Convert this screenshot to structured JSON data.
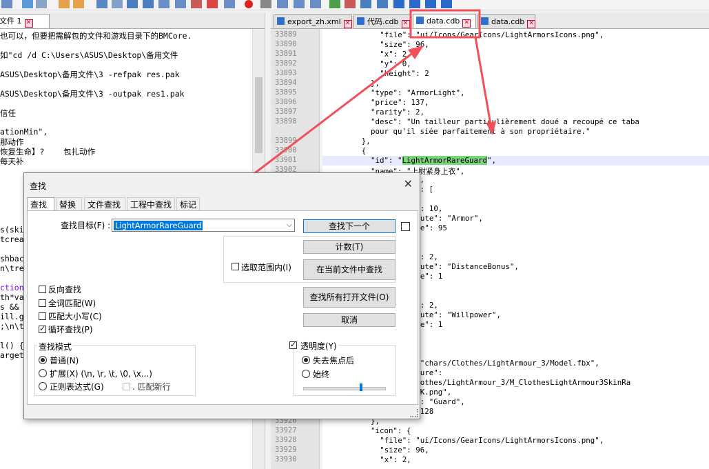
{
  "left": {
    "tab_label": "文件 1",
    "lines": [
      "也可以，但要把需解包的文件和游戏目录下的BMCore.",
      "",
      "如\"cd /d C:\\Users\\ASUS\\Desktop\\备用文件",
      "",
      "ASUS\\Desktop\\备用文件\\3 -refpak res.pak",
      "",
      "ASUS\\Desktop\\备用文件\\3 -outpak res1.pak",
      "",
      "信任",
      "",
      "ationMin\",",
      "那动作",
      "恢复生命】?    包扎动作",
      "每天补"
    ],
    "lines2": [
      "s(ski",
      "tcrea",
      "",
      "shbac",
      "n\\tre",
      "",
      "ction",
      "th*va",
      "s &&",
      "ill.g",
      ";\\n\\t",
      "",
      "l() {",
      "arget"
    ]
  },
  "right": {
    "tabs": [
      {
        "label": "export_zh.xml"
      },
      {
        "label": "代码.cdb"
      },
      {
        "label": "data.cdb"
      },
      {
        "label": "data.cdb"
      }
    ],
    "gutter": [
      "33889",
      "33890",
      "33891",
      "33892",
      "33893",
      "33894",
      "33895",
      "33896",
      "33897",
      "33898",
      "",
      "33899",
      "33900",
      "33901",
      "33902",
      "",
      "",
      "",
      "",
      "",
      "",
      "",
      "",
      "",
      "",
      "",
      "",
      "",
      "",
      "",
      "",
      "",
      "",
      "",
      "",
      "",
      "",
      "",
      "",
      "",
      "33926",
      "33927",
      "33928",
      "33929",
      "33930"
    ],
    "code": [
      {
        "t": "\"file\": \"ui/Icons/GearIcons/LightArmorsIcons.png\",",
        "i": 12
      },
      {
        "t": "\"size\": 96,",
        "i": 12
      },
      {
        "t": "\"x\": 2,",
        "i": 12
      },
      {
        "t": "\"y\": 0,",
        "i": 12
      },
      {
        "t": "\"height\": 2",
        "i": 12
      },
      {
        "t": "},",
        "i": 10
      },
      {
        "t": "\"type\": \"ArmorLight\",",
        "i": 10
      },
      {
        "t": "\"price\": 137,",
        "i": 10
      },
      {
        "t": "\"rarity\": 2,",
        "i": 10
      },
      {
        "t": "\"desc\": \"Un tailleur particulièrement doué a recoupé ce taba",
        "i": 10
      },
      {
        "t": "pour qu'il siée parfaitement à son propriétaire.\"",
        "i": 10
      },
      {
        "t": "},",
        "i": 8
      },
      {
        "t": "{",
        "i": 8
      },
      {
        "t": "\"id\": \"LightArmorRareGuard\",",
        "i": 10
      },
      {
        "t": "\"name\": \"上尉紧身上衣\",",
        "i": 10
      },
      {
        "t": "\"weight\": 2,",
        "i": 10
      },
      {
        "t": "\"baseBonus\": [",
        "i": 10
      },
      {
        "t": "{",
        "i": 12
      },
      {
        "t": "\"value\": 10,",
        "i": 14
      },
      {
        "t": "\"attribute\": \"Armor\",",
        "i": 14
      },
      {
        "t": "\"upValue\": 95",
        "i": 14
      },
      {
        "t": "},",
        "i": 12
      },
      {
        "t": "{",
        "i": 12
      },
      {
        "t": "\"value\": 2,",
        "i": 14
      },
      {
        "t": "\"attribute\": \"DistanceBonus\",",
        "i": 14
      },
      {
        "t": "\"upValue\": 1",
        "i": 14
      },
      {
        "t": "},",
        "i": 12
      },
      {
        "t": "{",
        "i": 12
      },
      {
        "t": "\"value\": 2,",
        "i": 14
      },
      {
        "t": "\"attribute\": \"Willpower\",",
        "i": 14
      },
      {
        "t": "\"upValue\": 1",
        "i": 14
      },
      {
        "t": "}",
        "i": 12
      },
      {
        "t": "],",
        "i": 10
      },
      {
        "t": "\"props\": {",
        "i": 10
      },
      {
        "t": "\"model\": \"chars/Clothes/LightArmour_3/Model.fbx\",",
        "i": 12
      },
      {
        "t": "\"skinTexture\":",
        "i": 12
      },
      {
        "t": "\"chars/Clothes/LightArmour_3/M_ClothesLightArmour3SkinRa",
        "i": 12
      },
      {
        "t": "_Albedo_1K.png\",",
        "i": 12
      },
      {
        "t": "\"faction\": \"Guard\",",
        "i": 12
      },
      {
        "t": "\"flags\": 128",
        "i": 12
      },
      {
        "t": "},",
        "i": 10
      },
      {
        "t": "\"icon\": {",
        "i": 10
      },
      {
        "t": "\"file\": \"ui/Icons/GearIcons/LightArmorsIcons.png\",",
        "i": 12
      },
      {
        "t": "\"size\": 96,",
        "i": 12
      },
      {
        "t": "\"x\": 2,",
        "i": 12
      }
    ],
    "highlight_word": "LightArmorRareGuard"
  },
  "dialog": {
    "title": "查找",
    "close": "✕",
    "tabs": [
      "查找",
      "替换",
      "文件查找",
      "工程中查找",
      "标记"
    ],
    "find_label": "查找目标(F) :",
    "find_value": "LightArmorRareGuard",
    "btn_find_next": "查找下一个",
    "btn_count": "计数(T)",
    "btn_find_in_current": "在当前文件中查找",
    "btn_find_all_open": "查找所有打开文件(O)",
    "btn_cancel": "取消",
    "in_selection": "选取范围内(I)",
    "opt_backward": "反向查找",
    "opt_whole_word": "全词匹配(W)",
    "opt_match_case": "匹配大小写(C)",
    "opt_wrap": "循环查找(P)",
    "mode_title": "查找模式",
    "mode_normal": "普通(N)",
    "mode_extended": "扩展(X) (\\n, \\r, \\t, \\0, \\x...)",
    "mode_regex": "正则表达式(G)",
    "match_newline": ". 匹配新行",
    "transparency": "透明度(Y)",
    "trans_on_lose_focus": "失去焦点后",
    "trans_always": "始终"
  }
}
